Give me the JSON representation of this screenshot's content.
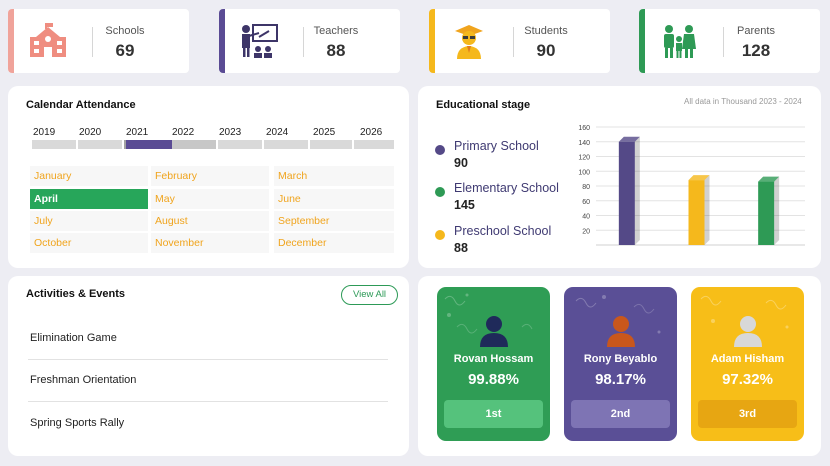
{
  "stats": [
    {
      "label": "Schools",
      "value": "69",
      "color": "#f0a39a",
      "icon": "school-icon"
    },
    {
      "label": "Teachers",
      "value": "88",
      "color": "#5a4b94",
      "icon": "teacher-icon"
    },
    {
      "label": "Students",
      "value": "90",
      "color": "#f5b81c",
      "icon": "student-icon"
    },
    {
      "label": "Parents",
      "value": "128",
      "color": "#2e9a55",
      "icon": "parents-icon"
    }
  ],
  "calendar": {
    "title": "Calendar Attendance",
    "years": [
      "2019",
      "2020",
      "2021",
      "2022",
      "2023",
      "2024",
      "2025",
      "2026"
    ],
    "selected_year": "2021",
    "months": [
      "January",
      "February",
      "March",
      "April",
      "May",
      "June",
      "July",
      "August",
      "September",
      "October",
      "November",
      "December"
    ],
    "selected_month": "April"
  },
  "stage": {
    "title": "Educational stage",
    "note": "All data in Thousand 2023 - 2024",
    "items": [
      {
        "name": "Primary School",
        "value": "90",
        "color": "#544987"
      },
      {
        "name": "Elementary School",
        "value": "145",
        "color": "#2e9a55"
      },
      {
        "name": "Preschool School",
        "value": "88",
        "color": "#f5b81c"
      }
    ]
  },
  "chart_data": {
    "type": "bar",
    "categories": [
      "Primary School",
      "Elementary School",
      "Preschool School"
    ],
    "values": [
      140,
      88,
      86
    ],
    "colors": [
      "#544987",
      "#f5b81c",
      "#2e9a55"
    ],
    "ylim": [
      0,
      160
    ],
    "yticks": [
      20,
      40,
      60,
      80,
      100,
      120,
      140,
      160
    ],
    "grid": true
  },
  "activities": {
    "title": "Activities & Events",
    "view_all": "View All",
    "items": [
      "Elimination Game",
      "Freshman Orientation",
      "Spring Sports Rally"
    ]
  },
  "ranking": [
    {
      "name": "Rovan Hossam",
      "pct": "99.88%",
      "rank": "1st",
      "color": "#2f9d55",
      "btn": "#55c27c",
      "head": "#1f2a5a"
    },
    {
      "name": "Rony Beyablo",
      "pct": "98.17%",
      "rank": "2nd",
      "color": "#5a4f96",
      "btn": "#7e74b4",
      "head": "#c9571c"
    },
    {
      "name": "Adam Hisham",
      "pct": "97.32%",
      "rank": "3rd",
      "color": "#f7be18",
      "btn": "#e7a612",
      "head": "#d8d8d8"
    }
  ]
}
